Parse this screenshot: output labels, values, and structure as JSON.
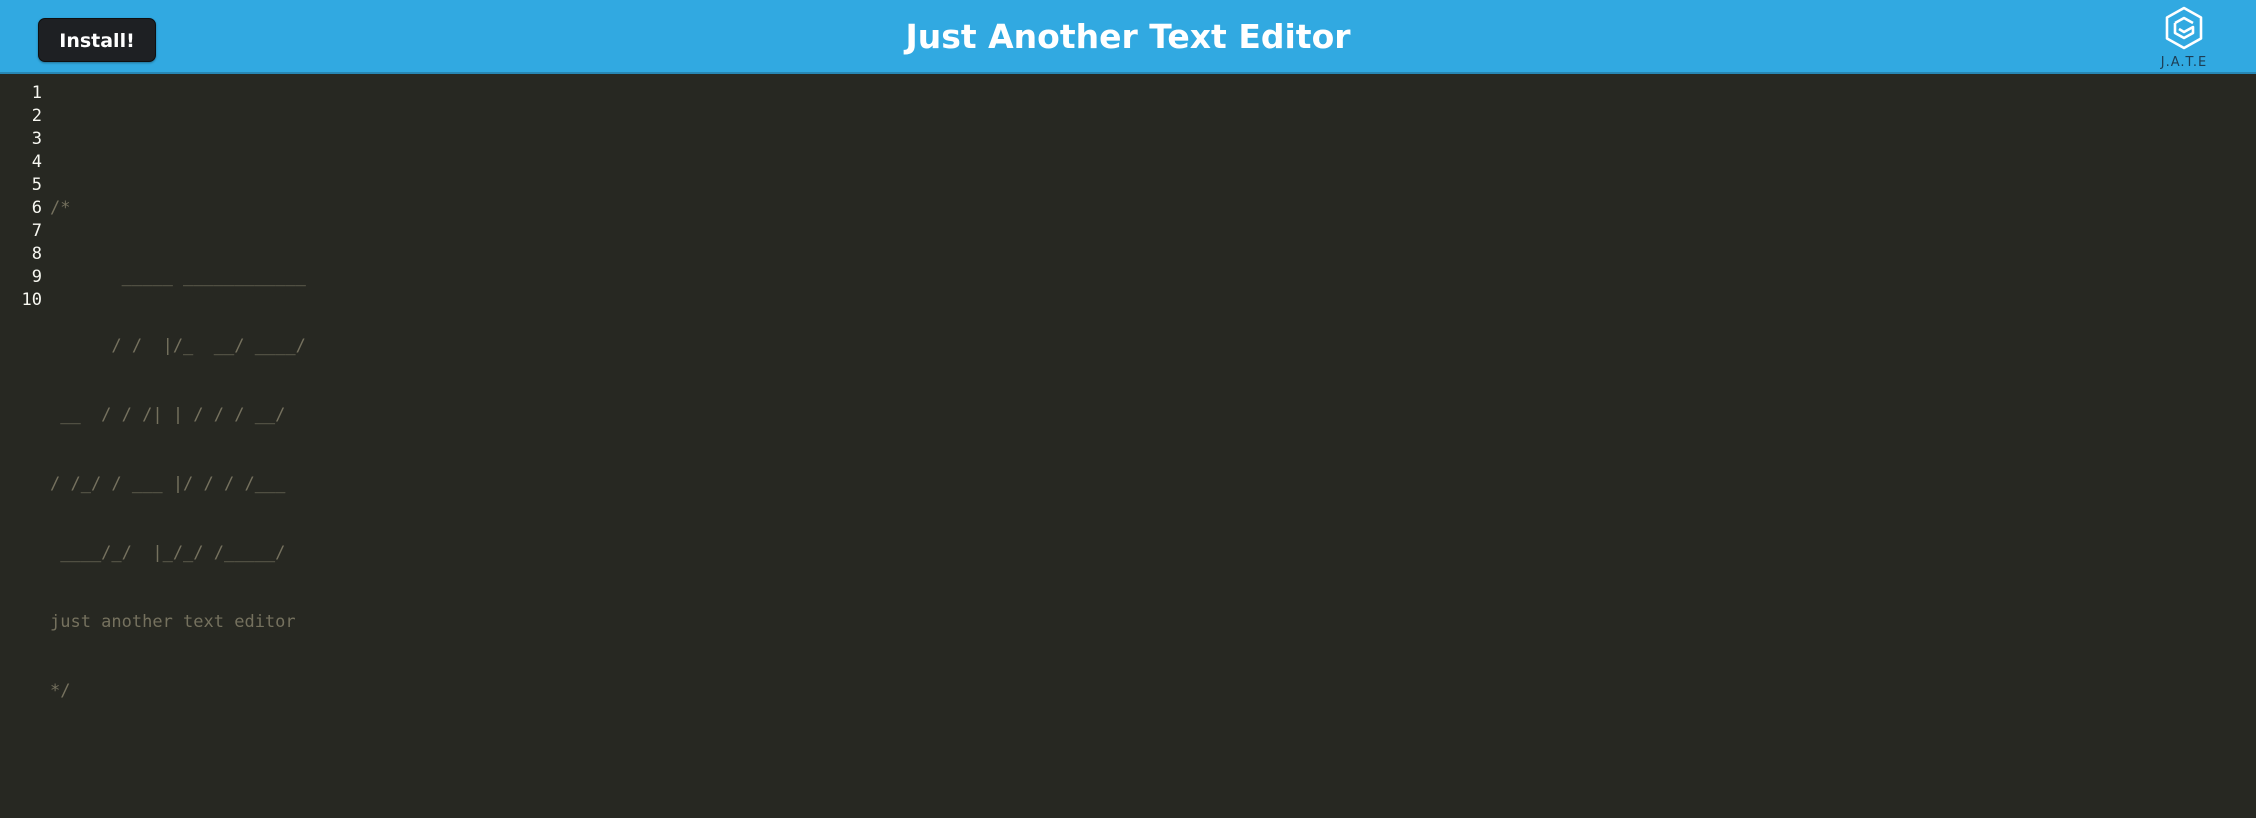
{
  "header": {
    "install_label": "Install!",
    "title": "Just Another Text Editor",
    "logo_text": "J.A.T.E",
    "background_color": "#31a9e1"
  },
  "editor": {
    "background_color": "#272822",
    "comment_color": "#75715e",
    "line_numbers": [
      "1",
      "2",
      "3",
      "4",
      "5",
      "6",
      "7",
      "8",
      "9",
      "10"
    ],
    "lines": [
      "",
      "/*",
      "       _____ ____________",
      "      / /  |/_  __/ ____/",
      " __  / / /| | / / / __/",
      "/ /_/ / ___ |/ / / /___",
      " ____/_/  |_/_/ /_____/",
      "just another text editor",
      "*/",
      ""
    ]
  }
}
